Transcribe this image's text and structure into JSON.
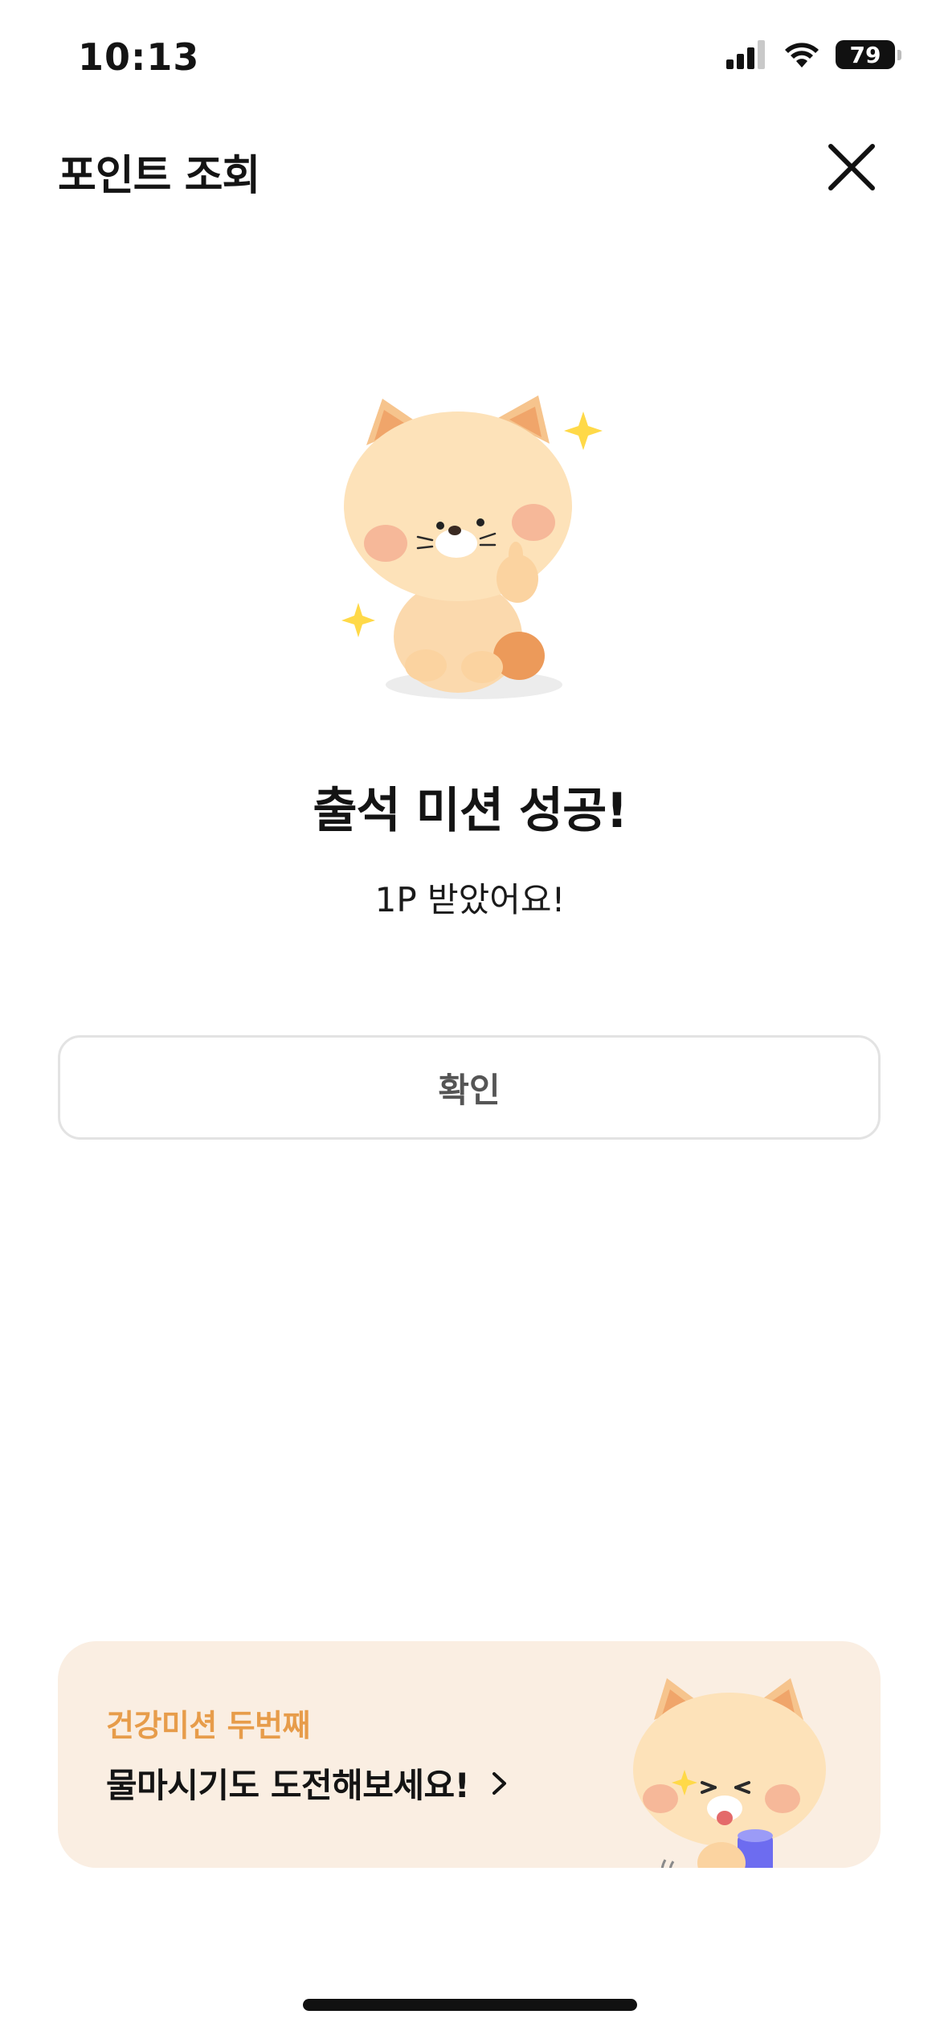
{
  "status_bar": {
    "time": "10:13",
    "battery": "79"
  },
  "header": {
    "title": "포인트 조회"
  },
  "result": {
    "title": "출석 미션 성공!",
    "subtitle": "1P 받았어요!"
  },
  "confirm": {
    "label": "확인"
  },
  "banner": {
    "eyebrow": "건강미션 두번째",
    "title": "물마시기도 도전해보세요!"
  },
  "colors": {
    "accent_orange": "#e79c4a",
    "banner_bg": "#faeee2"
  }
}
